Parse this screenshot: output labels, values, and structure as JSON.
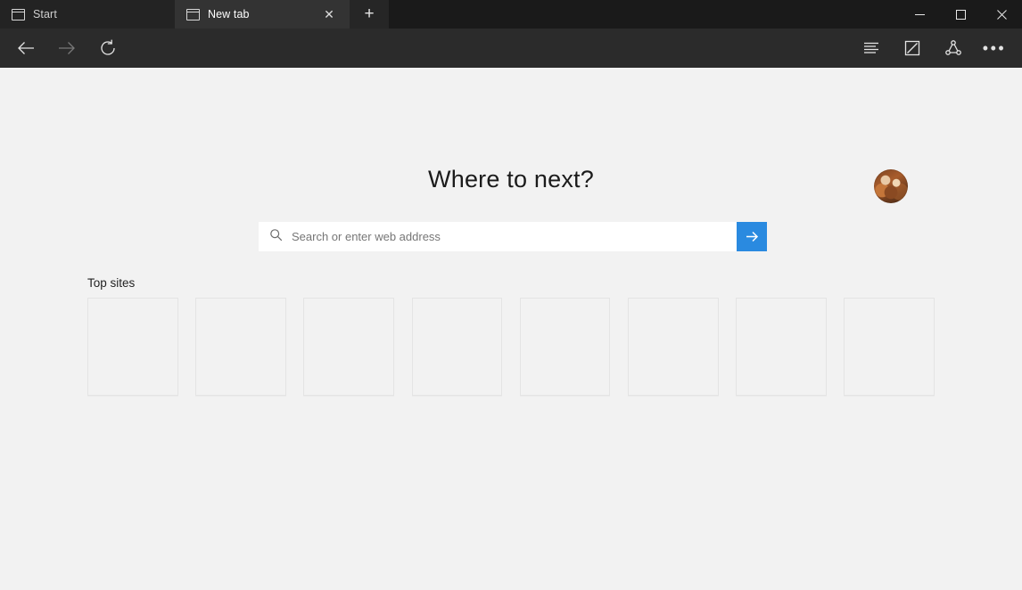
{
  "window": {
    "controls": [
      {
        "name": "minimize",
        "label": "Minimize"
      },
      {
        "name": "maximize",
        "label": "Maximize"
      },
      {
        "name": "close",
        "label": "Close"
      }
    ]
  },
  "tabstrip": {
    "tabs": [
      {
        "title": "Start",
        "favicon": "window-icon",
        "active": false,
        "closable": false
      },
      {
        "title": "New tab",
        "favicon": "window-icon",
        "active": true,
        "closable": true
      }
    ],
    "close_glyph": "✕",
    "new_tab_glyph": "+",
    "new_tab_name": "new-tab-button"
  },
  "toolbar": {
    "back": {
      "name": "back-button",
      "enabled": true
    },
    "forward": {
      "name": "forward-button",
      "enabled": false
    },
    "refresh": {
      "name": "refresh-button",
      "enabled": true
    },
    "hub": {
      "name": "hub-favorites-button"
    },
    "web_note": {
      "name": "make-a-web-note-button"
    },
    "share": {
      "name": "share-button"
    },
    "more": {
      "name": "more-settings-button",
      "glyph": "•••"
    }
  },
  "page": {
    "heading": "Where to next?",
    "avatar_name": "profile-avatar",
    "search": {
      "placeholder": "Search or enter web address",
      "value": "",
      "go_name": "go-button"
    },
    "top_sites": {
      "label": "Top sites",
      "tiles": [
        {
          "label": ""
        },
        {
          "label": ""
        },
        {
          "label": ""
        },
        {
          "label": ""
        },
        {
          "label": ""
        },
        {
          "label": ""
        },
        {
          "label": ""
        },
        {
          "label": ""
        }
      ]
    }
  },
  "colors": {
    "tabstrip_bg": "#1a1a1a",
    "tab_inactive_bg": "#232323",
    "tab_active_bg": "#333333",
    "toolbar_bg": "#2b2b2b",
    "page_bg": "#f2f2f2",
    "accent_blue": "#2a8ae0",
    "tile_border": "#e4e4e4"
  }
}
